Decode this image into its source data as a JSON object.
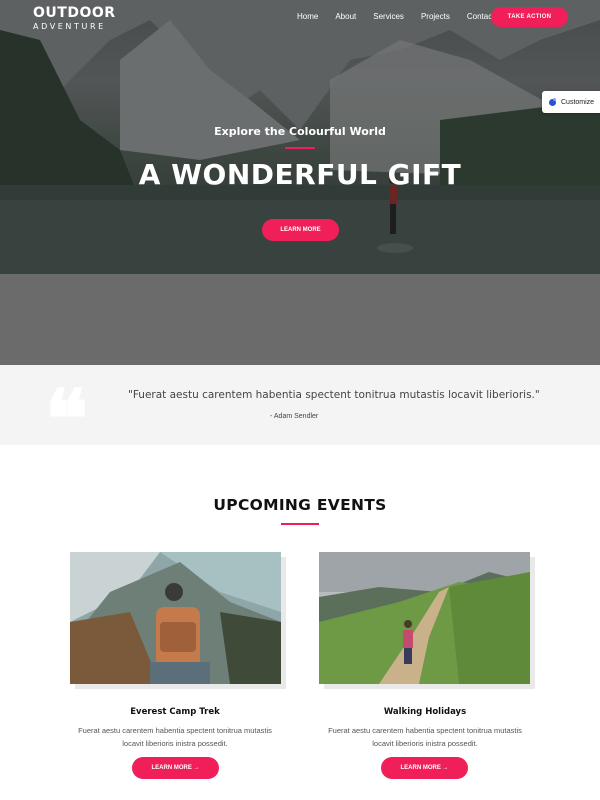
{
  "brand": {
    "line1": "OUTDOOR",
    "line2": "ADVENTURE"
  },
  "nav": {
    "items": [
      "Home",
      "About",
      "Services",
      "Projects",
      "Contact"
    ],
    "cta": "TAKE ACTION"
  },
  "customize": {
    "label": "Customize"
  },
  "hero": {
    "subtitle": "Explore the Colourful World",
    "title": "A WONDERFUL GIFT",
    "button": "LEARN MORE"
  },
  "quote": {
    "text": "\"Fuerat aestu carentem habentia spectent tonitrua mutastis locavit liberioris.\"",
    "author": "- Adam Sendler"
  },
  "events": {
    "title": "UPCOMING EVENTS",
    "cards": [
      {
        "title": "Everest Camp Trek",
        "line1": "Fuerat aestu carentem habentia spectent tonitrua mutastis",
        "line2": "locavit liberioris inistra possedit.",
        "button": "LEARN MORE →"
      },
      {
        "title": "Walking Holidays",
        "line1": "Fuerat aestu carentem habentia spectent tonitrua mutastis",
        "line2": "locavit liberioris inistra possedit.",
        "button": "LEARN MORE →"
      }
    ]
  },
  "colors": {
    "accent": "#f01f5a",
    "quote_bg": "#f4f4f4",
    "band_grey": "#6b6b6b"
  }
}
